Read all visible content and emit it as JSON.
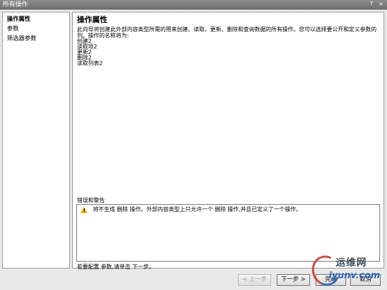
{
  "window": {
    "title": "所有操作",
    "help_glyph": "?",
    "close_glyph": "×"
  },
  "sidebar": {
    "items": [
      {
        "label": "操作属性",
        "active": true
      },
      {
        "label": "参数",
        "active": false
      },
      {
        "label": "筛选器参数",
        "active": false
      }
    ]
  },
  "main": {
    "title": "操作属性",
    "description": "此向导将创建此外部内容类型所需的用来创建、读取、更新、删除和查询数据的所有操作。您可以选择要公开和定义参数的列。操作的名称将为:",
    "operations": [
      "创建2",
      "读取项2",
      "更新2",
      "删除2",
      "读取列表2"
    ]
  },
  "errors": {
    "label": "错误和警告",
    "items": [
      {
        "icon": "warning-icon",
        "text": "将不生成 删除 操作。外部内容类型上只允许一个 删除 操作,并且已定义了一个操作。"
      }
    ]
  },
  "hint": "若要配置 参数,请单击 下一步。",
  "footer": {
    "prev_label": "< 上一步",
    "next_label": "下一步 >",
    "finish_label": "完成",
    "cancel_label": "取消"
  },
  "watermark": {
    "cn": "运维网",
    "en": "iyunv.com"
  }
}
